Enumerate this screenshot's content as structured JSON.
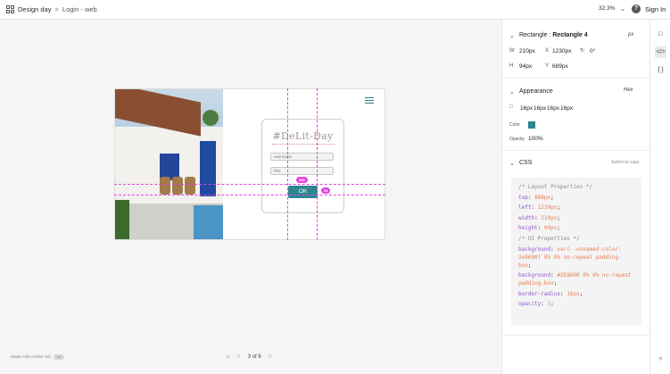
{
  "header": {
    "project": "Design day",
    "separator": ">",
    "screen": "Login - web",
    "zoom": "32.3%",
    "zoom_dropdown": "⌄",
    "help": "?",
    "sign_in": "Sign In"
  },
  "artboard": {
    "logo": "#DeLit-Day",
    "username_placeholder": "username",
    "pin_placeholder": "PIN",
    "ok_label": "OK",
    "measure_top": "280",
    "measure_right": "94"
  },
  "footer": {
    "made_with": "Made with Adobe XD",
    "page_indicator": "3 of 8",
    "prev": "<",
    "next": ">"
  },
  "inspect": {
    "selection": {
      "title_prefix": "Rectangle :",
      "title_name": "Rectangle 4",
      "unit": "px",
      "w_label": "W",
      "w_value": "210px",
      "x_label": "X",
      "x_value": "1230px",
      "rot_value": "0°",
      "h_label": "H",
      "h_value": "94px",
      "y_label": "Y",
      "y_value": "689px"
    },
    "appearance": {
      "title": "Appearance",
      "color_format": "Hex",
      "radii": [
        "16px",
        "16px",
        "16px",
        "16px"
      ],
      "color_label": "Color",
      "color_hex": "#2E8690",
      "opacity_label": "Opacity",
      "opacity_value": "100%"
    },
    "css": {
      "title": "CSS",
      "select_hint": "Select to copy",
      "comment_layout": "/* Layout Properties */",
      "lines_layout": [
        {
          "prop": "top",
          "val": "689px"
        },
        {
          "prop": "left",
          "val": "1230px"
        },
        {
          "prop": "width",
          "val": "210px"
        },
        {
          "prop": "height",
          "val": "94px"
        }
      ],
      "comment_ui": "/* UI Properties */",
      "lines_ui": [
        {
          "prop": "background",
          "val": "var(--unnamed-color-2e8690) 0% 0% no-repeat padding-box"
        },
        {
          "prop": "background",
          "val": "#2E8690 0% 0% no-repeat padding-box"
        },
        {
          "prop": "border-radius",
          "val": "16px"
        },
        {
          "prop": "opacity",
          "val": "1"
        }
      ]
    }
  },
  "colors": {
    "accent": "#2E8690",
    "guide": "#E046E0"
  }
}
